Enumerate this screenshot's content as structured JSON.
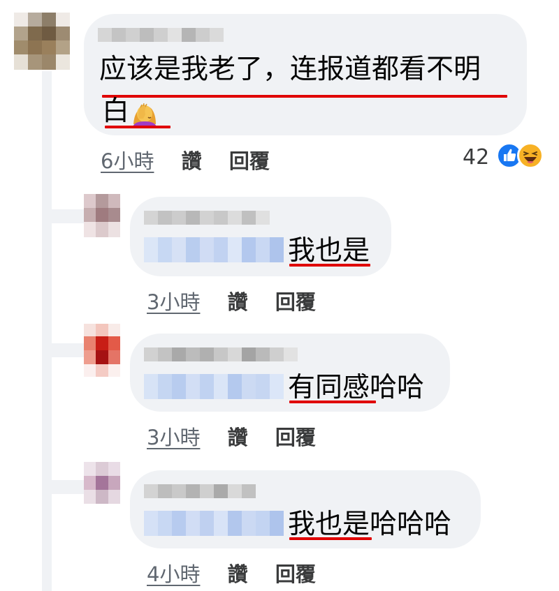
{
  "colors": {
    "bubble": "#f0f2f5",
    "underline": "#e00000",
    "like_blue": "#1877f2",
    "haha_yellow": "#f7b125"
  },
  "main_comment": {
    "text_line1": "应该是我老了，连报道都看不明",
    "text_line2": "白",
    "emoji": "facepalm-woman-emoji",
    "time": "6小時",
    "like_label": "讚",
    "reply_label": "回覆",
    "reaction_count": "42",
    "reaction_icons": [
      "like-icon",
      "haha-icon"
    ]
  },
  "replies": [
    {
      "text": "我也是",
      "time": "3小時",
      "like_label": "讚",
      "reply_label": "回覆"
    },
    {
      "text_underlined": "有同感",
      "text_rest": "哈哈",
      "time": "3小時",
      "like_label": "讚",
      "reply_label": "回覆"
    },
    {
      "text_underlined": "我也是",
      "text_rest": "哈哈哈",
      "time": "4小時",
      "like_label": "讚",
      "reply_label": "回覆"
    }
  ]
}
